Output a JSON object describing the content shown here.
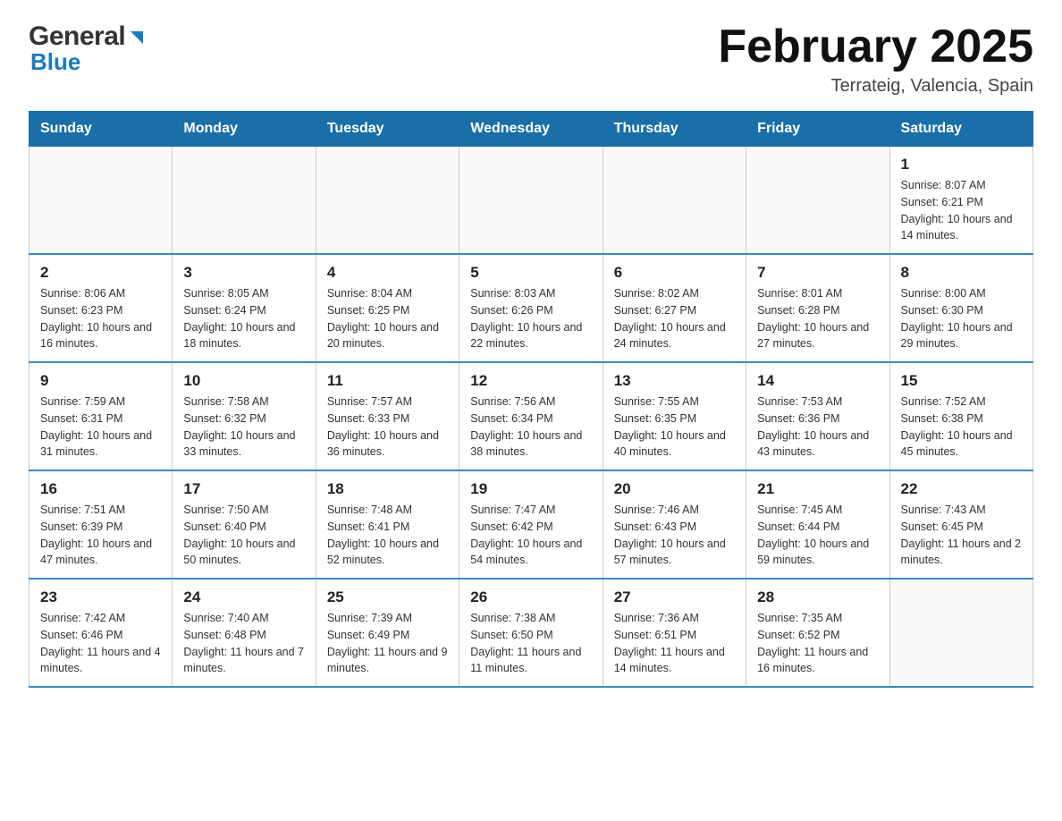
{
  "header": {
    "logo_general": "General",
    "logo_blue": "Blue",
    "title": "February 2025",
    "subtitle": "Terrateig, Valencia, Spain"
  },
  "days_of_week": [
    "Sunday",
    "Monday",
    "Tuesday",
    "Wednesday",
    "Thursday",
    "Friday",
    "Saturday"
  ],
  "weeks": [
    {
      "days": [
        {
          "number": "",
          "info": ""
        },
        {
          "number": "",
          "info": ""
        },
        {
          "number": "",
          "info": ""
        },
        {
          "number": "",
          "info": ""
        },
        {
          "number": "",
          "info": ""
        },
        {
          "number": "",
          "info": ""
        },
        {
          "number": "1",
          "info": "Sunrise: 8:07 AM\nSunset: 6:21 PM\nDaylight: 10 hours and 14 minutes."
        }
      ]
    },
    {
      "days": [
        {
          "number": "2",
          "info": "Sunrise: 8:06 AM\nSunset: 6:23 PM\nDaylight: 10 hours and 16 minutes."
        },
        {
          "number": "3",
          "info": "Sunrise: 8:05 AM\nSunset: 6:24 PM\nDaylight: 10 hours and 18 minutes."
        },
        {
          "number": "4",
          "info": "Sunrise: 8:04 AM\nSunset: 6:25 PM\nDaylight: 10 hours and 20 minutes."
        },
        {
          "number": "5",
          "info": "Sunrise: 8:03 AM\nSunset: 6:26 PM\nDaylight: 10 hours and 22 minutes."
        },
        {
          "number": "6",
          "info": "Sunrise: 8:02 AM\nSunset: 6:27 PM\nDaylight: 10 hours and 24 minutes."
        },
        {
          "number": "7",
          "info": "Sunrise: 8:01 AM\nSunset: 6:28 PM\nDaylight: 10 hours and 27 minutes."
        },
        {
          "number": "8",
          "info": "Sunrise: 8:00 AM\nSunset: 6:30 PM\nDaylight: 10 hours and 29 minutes."
        }
      ]
    },
    {
      "days": [
        {
          "number": "9",
          "info": "Sunrise: 7:59 AM\nSunset: 6:31 PM\nDaylight: 10 hours and 31 minutes."
        },
        {
          "number": "10",
          "info": "Sunrise: 7:58 AM\nSunset: 6:32 PM\nDaylight: 10 hours and 33 minutes."
        },
        {
          "number": "11",
          "info": "Sunrise: 7:57 AM\nSunset: 6:33 PM\nDaylight: 10 hours and 36 minutes."
        },
        {
          "number": "12",
          "info": "Sunrise: 7:56 AM\nSunset: 6:34 PM\nDaylight: 10 hours and 38 minutes."
        },
        {
          "number": "13",
          "info": "Sunrise: 7:55 AM\nSunset: 6:35 PM\nDaylight: 10 hours and 40 minutes."
        },
        {
          "number": "14",
          "info": "Sunrise: 7:53 AM\nSunset: 6:36 PM\nDaylight: 10 hours and 43 minutes."
        },
        {
          "number": "15",
          "info": "Sunrise: 7:52 AM\nSunset: 6:38 PM\nDaylight: 10 hours and 45 minutes."
        }
      ]
    },
    {
      "days": [
        {
          "number": "16",
          "info": "Sunrise: 7:51 AM\nSunset: 6:39 PM\nDaylight: 10 hours and 47 minutes."
        },
        {
          "number": "17",
          "info": "Sunrise: 7:50 AM\nSunset: 6:40 PM\nDaylight: 10 hours and 50 minutes."
        },
        {
          "number": "18",
          "info": "Sunrise: 7:48 AM\nSunset: 6:41 PM\nDaylight: 10 hours and 52 minutes."
        },
        {
          "number": "19",
          "info": "Sunrise: 7:47 AM\nSunset: 6:42 PM\nDaylight: 10 hours and 54 minutes."
        },
        {
          "number": "20",
          "info": "Sunrise: 7:46 AM\nSunset: 6:43 PM\nDaylight: 10 hours and 57 minutes."
        },
        {
          "number": "21",
          "info": "Sunrise: 7:45 AM\nSunset: 6:44 PM\nDaylight: 10 hours and 59 minutes."
        },
        {
          "number": "22",
          "info": "Sunrise: 7:43 AM\nSunset: 6:45 PM\nDaylight: 11 hours and 2 minutes."
        }
      ]
    },
    {
      "days": [
        {
          "number": "23",
          "info": "Sunrise: 7:42 AM\nSunset: 6:46 PM\nDaylight: 11 hours and 4 minutes."
        },
        {
          "number": "24",
          "info": "Sunrise: 7:40 AM\nSunset: 6:48 PM\nDaylight: 11 hours and 7 minutes."
        },
        {
          "number": "25",
          "info": "Sunrise: 7:39 AM\nSunset: 6:49 PM\nDaylight: 11 hours and 9 minutes."
        },
        {
          "number": "26",
          "info": "Sunrise: 7:38 AM\nSunset: 6:50 PM\nDaylight: 11 hours and 11 minutes."
        },
        {
          "number": "27",
          "info": "Sunrise: 7:36 AM\nSunset: 6:51 PM\nDaylight: 11 hours and 14 minutes."
        },
        {
          "number": "28",
          "info": "Sunrise: 7:35 AM\nSunset: 6:52 PM\nDaylight: 11 hours and 16 minutes."
        },
        {
          "number": "",
          "info": ""
        }
      ]
    }
  ]
}
